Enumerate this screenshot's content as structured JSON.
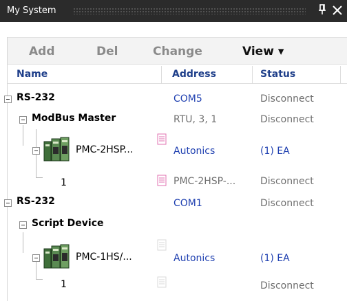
{
  "window": {
    "title": "My System",
    "pin_glyph": "P",
    "close_glyph": "✕"
  },
  "toolbar": {
    "add_label": "Add",
    "del_label": "Del",
    "change_label": "Change",
    "view_label": "View ▾"
  },
  "columns": {
    "name": "Name",
    "address": "Address",
    "status": "Status"
  },
  "rows": [
    {
      "label": "RS-232",
      "address": "COM5",
      "status": "Disconnect"
    },
    {
      "label": "ModBus Master",
      "address": "RTU, 3, 1",
      "status": "Disconnect"
    },
    {
      "label": "PMC-2HSP...",
      "address": "Autonics",
      "status": "(1) EA"
    },
    {
      "label": "1",
      "address": "PMC-2HSP-...",
      "status": "Disconnect"
    },
    {
      "label": "RS-232",
      "address": "COM1",
      "status": "Disconnect"
    },
    {
      "label": "Script Device",
      "address": "",
      "status": ""
    },
    {
      "label": "PMC-1HS/...",
      "address": "Autonics",
      "status": "(1) EA"
    },
    {
      "label": "1",
      "address": "",
      "status": "Disconnect"
    }
  ],
  "colors": {
    "titlebar": "#2b2b2b",
    "header_text": "#1f3f8a",
    "address_blue": "#1e3fb0",
    "doc_icon_pink": "#e070b0"
  },
  "icons": [
    "pin-icon",
    "close-icon",
    "expander-minus-icon",
    "motion-controller-device-icon",
    "document-icon"
  ]
}
